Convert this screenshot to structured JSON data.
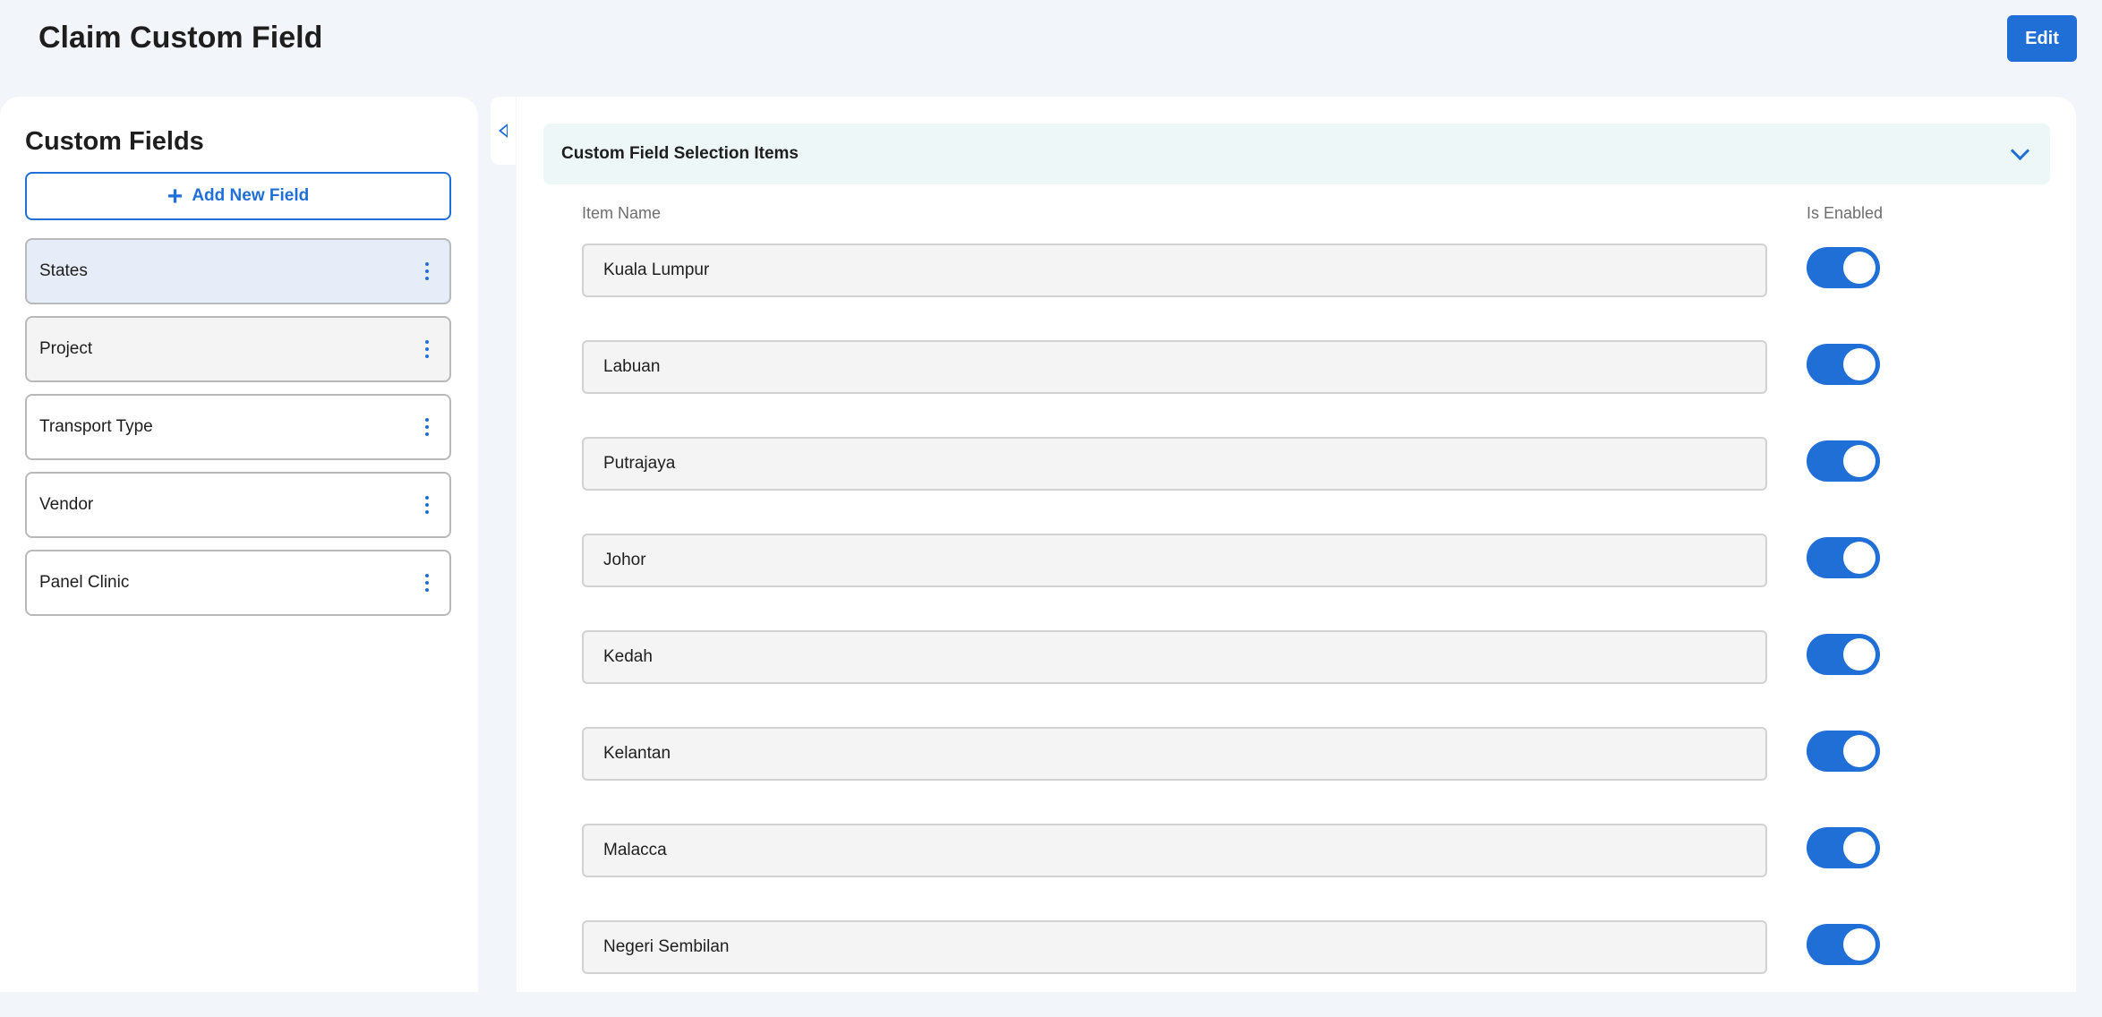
{
  "page": {
    "title": "Claim Custom Field",
    "edit_label": "Edit"
  },
  "sidebar": {
    "heading": "Custom Fields",
    "add_label": "Add New Field",
    "items": [
      {
        "label": "States"
      },
      {
        "label": "Project"
      },
      {
        "label": "Transport Type"
      },
      {
        "label": "Vendor"
      },
      {
        "label": "Panel Clinic"
      }
    ]
  },
  "main": {
    "section_title": "Custom Field Selection Items",
    "col_item_name": "Item Name",
    "col_is_enabled": "Is Enabled",
    "items": [
      {
        "name": "Kuala Lumpur",
        "enabled": true
      },
      {
        "name": "Labuan",
        "enabled": true
      },
      {
        "name": "Putrajaya",
        "enabled": true
      },
      {
        "name": "Johor",
        "enabled": true
      },
      {
        "name": "Kedah",
        "enabled": true
      },
      {
        "name": "Kelantan",
        "enabled": true
      },
      {
        "name": "Malacca",
        "enabled": true
      },
      {
        "name": "Negeri Sembilan",
        "enabled": true
      }
    ]
  },
  "colors": {
    "accent": "#1f6fd6",
    "page_bg": "#f2f5fa",
    "section_header_bg": "#edf7f7",
    "selected_item_bg": "#e7edf8"
  },
  "icons": {
    "add": "plus-icon",
    "item_menu": "kebab-icon",
    "collapse": "caret-left-icon",
    "section_toggle": "chevron-down-icon"
  }
}
